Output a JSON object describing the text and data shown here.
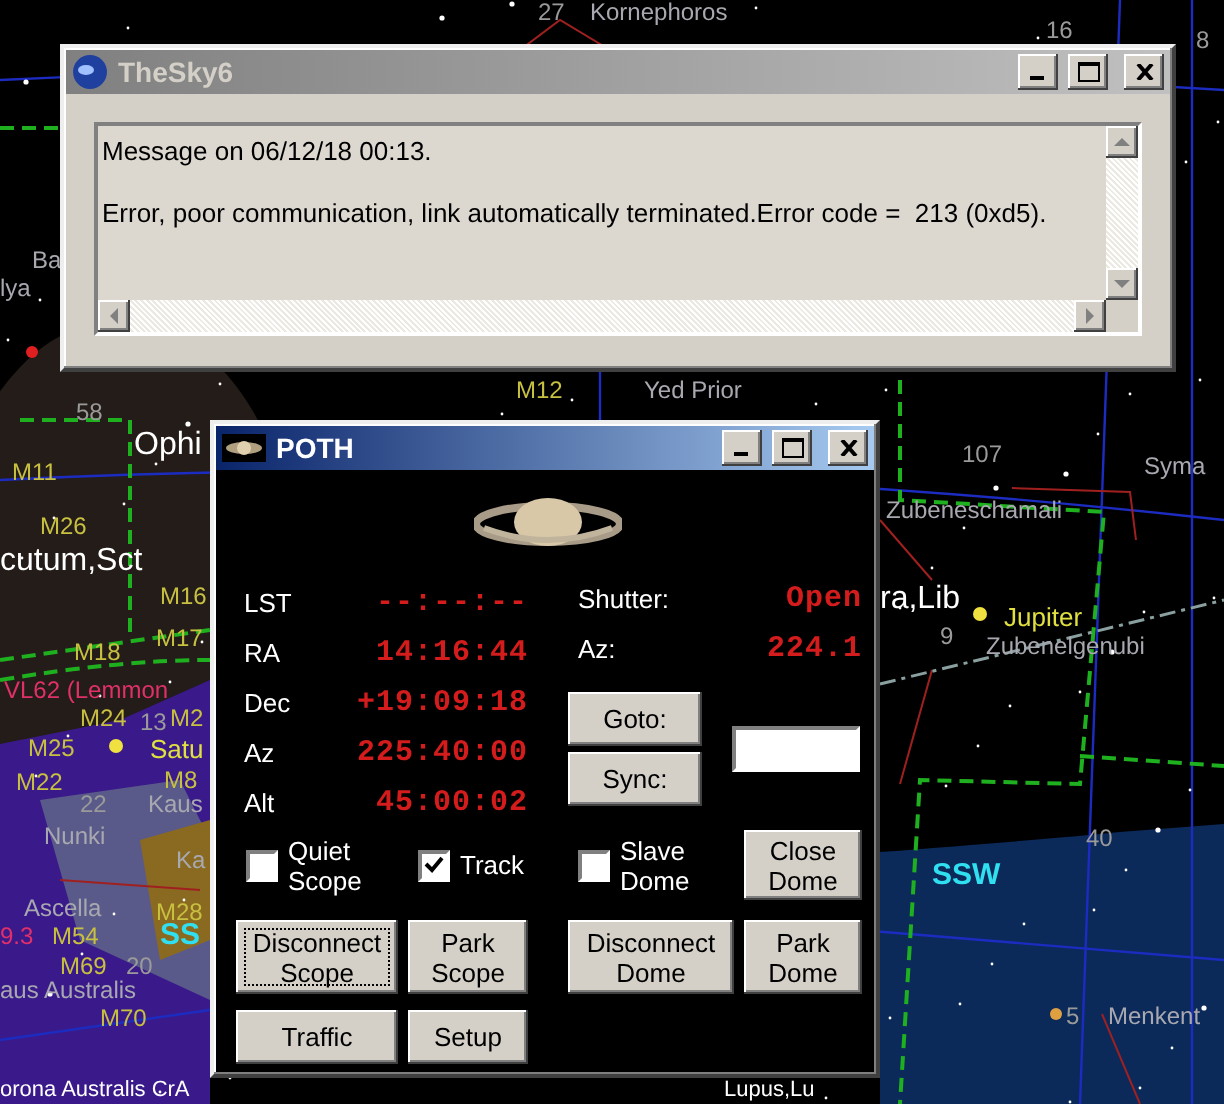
{
  "sky_chart": {
    "labels": [
      {
        "text": "27",
        "kind": "number"
      },
      {
        "text": "Kornephoros",
        "kind": "star"
      },
      {
        "text": "16",
        "kind": "number"
      },
      {
        "text": "8",
        "kind": "number"
      },
      {
        "text": "Ba",
        "kind": "star"
      },
      {
        "text": "lya",
        "kind": "star"
      },
      {
        "text": "M12",
        "kind": "messier"
      },
      {
        "text": "Yed Prior",
        "kind": "star"
      },
      {
        "text": "58",
        "kind": "number"
      },
      {
        "text": "Ophi",
        "kind": "constellation"
      },
      {
        "text": "M11",
        "kind": "messier"
      },
      {
        "text": "M26",
        "kind": "messier"
      },
      {
        "text": "cutum,Sct",
        "kind": "constellation"
      },
      {
        "text": "M16",
        "kind": "messier"
      },
      {
        "text": "M17",
        "kind": "messier"
      },
      {
        "text": "M18",
        "kind": "messier"
      },
      {
        "text": "VL62 (Lemmon",
        "kind": "comet"
      },
      {
        "text": "M24",
        "kind": "messier"
      },
      {
        "text": "13",
        "kind": "number"
      },
      {
        "text": "M2",
        "kind": "messier"
      },
      {
        "text": "M25",
        "kind": "messier"
      },
      {
        "text": "Satu",
        "kind": "planet"
      },
      {
        "text": "M22",
        "kind": "messier"
      },
      {
        "text": "M8",
        "kind": "messier"
      },
      {
        "text": "22",
        "kind": "number"
      },
      {
        "text": "Kaus",
        "kind": "star"
      },
      {
        "text": "Nunki",
        "kind": "star"
      },
      {
        "text": "Ka",
        "kind": "star"
      },
      {
        "text": "Ascella",
        "kind": "star"
      },
      {
        "text": "M28",
        "kind": "messier"
      },
      {
        "text": "9.3",
        "kind": "comet"
      },
      {
        "text": "M54",
        "kind": "messier"
      },
      {
        "text": "SS",
        "kind": "compass"
      },
      {
        "text": "M69",
        "kind": "messier"
      },
      {
        "text": "20",
        "kind": "number"
      },
      {
        "text": "aus Australis",
        "kind": "star"
      },
      {
        "text": "M70",
        "kind": "messier"
      },
      {
        "text": "orona Australis CrA",
        "kind": "constellation"
      },
      {
        "text": "107",
        "kind": "number"
      },
      {
        "text": "Syma",
        "kind": "star"
      },
      {
        "text": "Zubeneschamali",
        "kind": "star"
      },
      {
        "text": "ra,Lib",
        "kind": "constellation"
      },
      {
        "text": "Jupiter",
        "kind": "planet"
      },
      {
        "text": "9",
        "kind": "number"
      },
      {
        "text": "Zubenelgenubi",
        "kind": "star"
      },
      {
        "text": "40",
        "kind": "number"
      },
      {
        "text": "SSW",
        "kind": "compass"
      },
      {
        "text": "5",
        "kind": "number"
      },
      {
        "text": "Menkent",
        "kind": "star"
      },
      {
        "text": "Lupus,Lu",
        "kind": "constellation"
      }
    ]
  },
  "message_window": {
    "title": "TheSky6",
    "active": false,
    "lines": [
      "Message on 06/12/18 00:13.",
      "Error, poor communication, link automatically terminated.Error code =  213 (0xd5)."
    ]
  },
  "poth": {
    "title": "POTH",
    "active": true,
    "readouts": [
      {
        "label": "LST",
        "value": "--:--:--"
      },
      {
        "label": "RA",
        "value": "14:16:44"
      },
      {
        "label": "Dec",
        "value": "+19:09:18"
      },
      {
        "label": "Az",
        "value": "225:40:00"
      },
      {
        "label": "Alt",
        "value": "45:00:02"
      }
    ],
    "dome": [
      {
        "label": "Shutter:",
        "value": "Open"
      },
      {
        "label": "Az:",
        "value": "224.1"
      }
    ],
    "goto": "Goto:",
    "sync": "Sync:",
    "checkboxes": [
      {
        "label": "Quiet Scope",
        "checked": false
      },
      {
        "label": "Track",
        "checked": true
      },
      {
        "label": "Slave Dome",
        "checked": false
      }
    ],
    "buttons": [
      {
        "label": "Close Dome",
        "focused": false
      },
      {
        "label": "Disconnect Scope",
        "focused": true
      },
      {
        "label": "Park Scope",
        "focused": false
      },
      {
        "label": "Disconnect Dome",
        "focused": false
      },
      {
        "label": "Park Dome",
        "focused": false
      },
      {
        "label": "Traffic",
        "focused": false
      },
      {
        "label": "Setup",
        "focused": false
      }
    ]
  }
}
